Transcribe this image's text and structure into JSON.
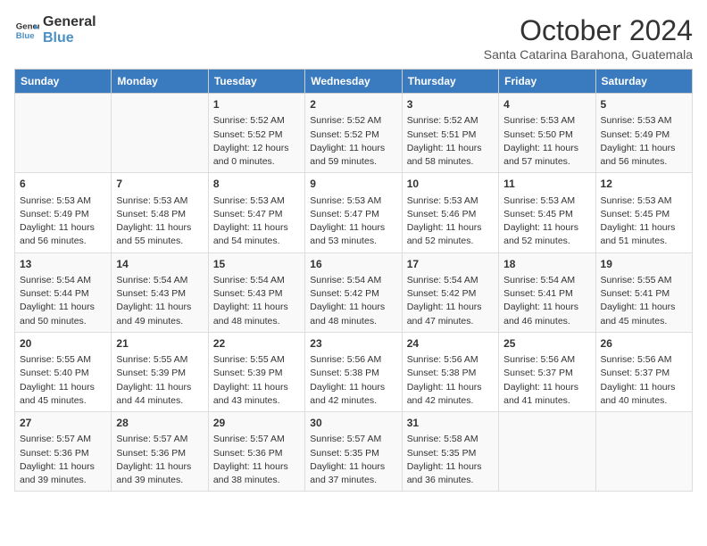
{
  "header": {
    "logo_line1": "General",
    "logo_line2": "Blue",
    "month": "October 2024",
    "location": "Santa Catarina Barahona, Guatemala"
  },
  "days_of_week": [
    "Sunday",
    "Monday",
    "Tuesday",
    "Wednesday",
    "Thursday",
    "Friday",
    "Saturday"
  ],
  "weeks": [
    [
      {
        "day": "",
        "info": ""
      },
      {
        "day": "",
        "info": ""
      },
      {
        "day": "1",
        "info": "Sunrise: 5:52 AM\nSunset: 5:52 PM\nDaylight: 12 hours\nand 0 minutes."
      },
      {
        "day": "2",
        "info": "Sunrise: 5:52 AM\nSunset: 5:52 PM\nDaylight: 11 hours\nand 59 minutes."
      },
      {
        "day": "3",
        "info": "Sunrise: 5:52 AM\nSunset: 5:51 PM\nDaylight: 11 hours\nand 58 minutes."
      },
      {
        "day": "4",
        "info": "Sunrise: 5:53 AM\nSunset: 5:50 PM\nDaylight: 11 hours\nand 57 minutes."
      },
      {
        "day": "5",
        "info": "Sunrise: 5:53 AM\nSunset: 5:49 PM\nDaylight: 11 hours\nand 56 minutes."
      }
    ],
    [
      {
        "day": "6",
        "info": "Sunrise: 5:53 AM\nSunset: 5:49 PM\nDaylight: 11 hours\nand 56 minutes."
      },
      {
        "day": "7",
        "info": "Sunrise: 5:53 AM\nSunset: 5:48 PM\nDaylight: 11 hours\nand 55 minutes."
      },
      {
        "day": "8",
        "info": "Sunrise: 5:53 AM\nSunset: 5:47 PM\nDaylight: 11 hours\nand 54 minutes."
      },
      {
        "day": "9",
        "info": "Sunrise: 5:53 AM\nSunset: 5:47 PM\nDaylight: 11 hours\nand 53 minutes."
      },
      {
        "day": "10",
        "info": "Sunrise: 5:53 AM\nSunset: 5:46 PM\nDaylight: 11 hours\nand 52 minutes."
      },
      {
        "day": "11",
        "info": "Sunrise: 5:53 AM\nSunset: 5:45 PM\nDaylight: 11 hours\nand 52 minutes."
      },
      {
        "day": "12",
        "info": "Sunrise: 5:53 AM\nSunset: 5:45 PM\nDaylight: 11 hours\nand 51 minutes."
      }
    ],
    [
      {
        "day": "13",
        "info": "Sunrise: 5:54 AM\nSunset: 5:44 PM\nDaylight: 11 hours\nand 50 minutes."
      },
      {
        "day": "14",
        "info": "Sunrise: 5:54 AM\nSunset: 5:43 PM\nDaylight: 11 hours\nand 49 minutes."
      },
      {
        "day": "15",
        "info": "Sunrise: 5:54 AM\nSunset: 5:43 PM\nDaylight: 11 hours\nand 48 minutes."
      },
      {
        "day": "16",
        "info": "Sunrise: 5:54 AM\nSunset: 5:42 PM\nDaylight: 11 hours\nand 48 minutes."
      },
      {
        "day": "17",
        "info": "Sunrise: 5:54 AM\nSunset: 5:42 PM\nDaylight: 11 hours\nand 47 minutes."
      },
      {
        "day": "18",
        "info": "Sunrise: 5:54 AM\nSunset: 5:41 PM\nDaylight: 11 hours\nand 46 minutes."
      },
      {
        "day": "19",
        "info": "Sunrise: 5:55 AM\nSunset: 5:41 PM\nDaylight: 11 hours\nand 45 minutes."
      }
    ],
    [
      {
        "day": "20",
        "info": "Sunrise: 5:55 AM\nSunset: 5:40 PM\nDaylight: 11 hours\nand 45 minutes."
      },
      {
        "day": "21",
        "info": "Sunrise: 5:55 AM\nSunset: 5:39 PM\nDaylight: 11 hours\nand 44 minutes."
      },
      {
        "day": "22",
        "info": "Sunrise: 5:55 AM\nSunset: 5:39 PM\nDaylight: 11 hours\nand 43 minutes."
      },
      {
        "day": "23",
        "info": "Sunrise: 5:56 AM\nSunset: 5:38 PM\nDaylight: 11 hours\nand 42 minutes."
      },
      {
        "day": "24",
        "info": "Sunrise: 5:56 AM\nSunset: 5:38 PM\nDaylight: 11 hours\nand 42 minutes."
      },
      {
        "day": "25",
        "info": "Sunrise: 5:56 AM\nSunset: 5:37 PM\nDaylight: 11 hours\nand 41 minutes."
      },
      {
        "day": "26",
        "info": "Sunrise: 5:56 AM\nSunset: 5:37 PM\nDaylight: 11 hours\nand 40 minutes."
      }
    ],
    [
      {
        "day": "27",
        "info": "Sunrise: 5:57 AM\nSunset: 5:36 PM\nDaylight: 11 hours\nand 39 minutes."
      },
      {
        "day": "28",
        "info": "Sunrise: 5:57 AM\nSunset: 5:36 PM\nDaylight: 11 hours\nand 39 minutes."
      },
      {
        "day": "29",
        "info": "Sunrise: 5:57 AM\nSunset: 5:36 PM\nDaylight: 11 hours\nand 38 minutes."
      },
      {
        "day": "30",
        "info": "Sunrise: 5:57 AM\nSunset: 5:35 PM\nDaylight: 11 hours\nand 37 minutes."
      },
      {
        "day": "31",
        "info": "Sunrise: 5:58 AM\nSunset: 5:35 PM\nDaylight: 11 hours\nand 36 minutes."
      },
      {
        "day": "",
        "info": ""
      },
      {
        "day": "",
        "info": ""
      }
    ]
  ]
}
